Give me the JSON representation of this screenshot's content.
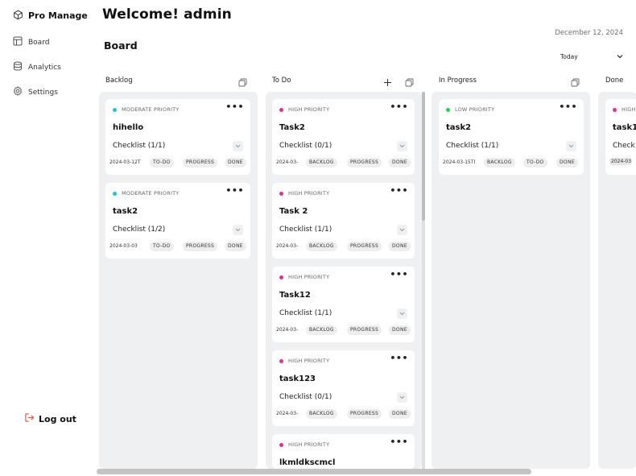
{
  "app": {
    "name": "Pro Manage"
  },
  "sidebar": {
    "items": [
      {
        "label": "Board",
        "icon": "layout-icon"
      },
      {
        "label": "Analytics",
        "icon": "database-icon"
      },
      {
        "label": "Settings",
        "icon": "gear-icon"
      }
    ],
    "logout_label": "Log out"
  },
  "header": {
    "welcome": "Welcome! admin",
    "date": "December 12, 2024",
    "board_title": "Board",
    "range": "Today"
  },
  "colors": {
    "moderate": "#21c0d8",
    "high": "#e0338f",
    "low": "#2ecc55",
    "logout": "#e35a4b"
  },
  "columns": [
    {
      "title": "Backlog",
      "cards": [
        {
          "priority": "MODERATE PRIORITY",
          "priority_level": "moderate",
          "title": "hihello",
          "checklist": "Checklist (1/1)",
          "date": "2024-03-12T",
          "tags": [
            "TO-DO",
            "PROGRESS",
            "DONE"
          ]
        },
        {
          "priority": "MODERATE PRIORITY",
          "priority_level": "moderate",
          "title": "task2",
          "checklist": "Checklist (1/2)",
          "date": "2024-03-03",
          "tags": [
            "TO-DO",
            "PROGRESS",
            "DONE"
          ]
        }
      ]
    },
    {
      "title": "To Do",
      "cards": [
        {
          "priority": "HIGH PRIORITY",
          "priority_level": "high",
          "title": "Task2",
          "checklist": "Checklist (0/1)",
          "date": "2024-03-",
          "tags": [
            "BACKLOG",
            "PROGRESS",
            "DONE"
          ]
        },
        {
          "priority": "HIGH PRIORITY",
          "priority_level": "high",
          "title": "Task 2",
          "checklist": "Checklist (1/1)",
          "date": "2024-03-",
          "tags": [
            "BACKLOG",
            "PROGRESS",
            "DONE"
          ]
        },
        {
          "priority": "HIGH PRIORITY",
          "priority_level": "high",
          "title": "Task12",
          "checklist": "Checklist (1/1)",
          "date": "2024-03-",
          "tags": [
            "BACKLOG",
            "PROGRESS",
            "DONE"
          ]
        },
        {
          "priority": "HIGH PRIORITY",
          "priority_level": "high",
          "title": "task123",
          "checklist": "Checklist (0/1)",
          "date": "2024-03-",
          "tags": [
            "BACKLOG",
            "PROGRESS",
            "DONE"
          ]
        },
        {
          "priority": "HIGH PRIORITY",
          "priority_level": "high",
          "title": "lkmldkscmcl",
          "checklist": "",
          "date": "",
          "tags": []
        }
      ]
    },
    {
      "title": "In Progress",
      "cards": [
        {
          "priority": "LOW PRIORITY",
          "priority_level": "low",
          "title": "task2",
          "checklist": "Checklist (1/1)",
          "date": "2024-03-15TI",
          "tags": [
            "BACKLOG",
            "TO-DO",
            "DONE"
          ]
        }
      ]
    },
    {
      "title": "Done",
      "cards": [
        {
          "priority": "HIGH",
          "priority_level": "high",
          "title": "task1",
          "checklist": "Check",
          "date": "2024-03",
          "tags": []
        }
      ]
    }
  ]
}
